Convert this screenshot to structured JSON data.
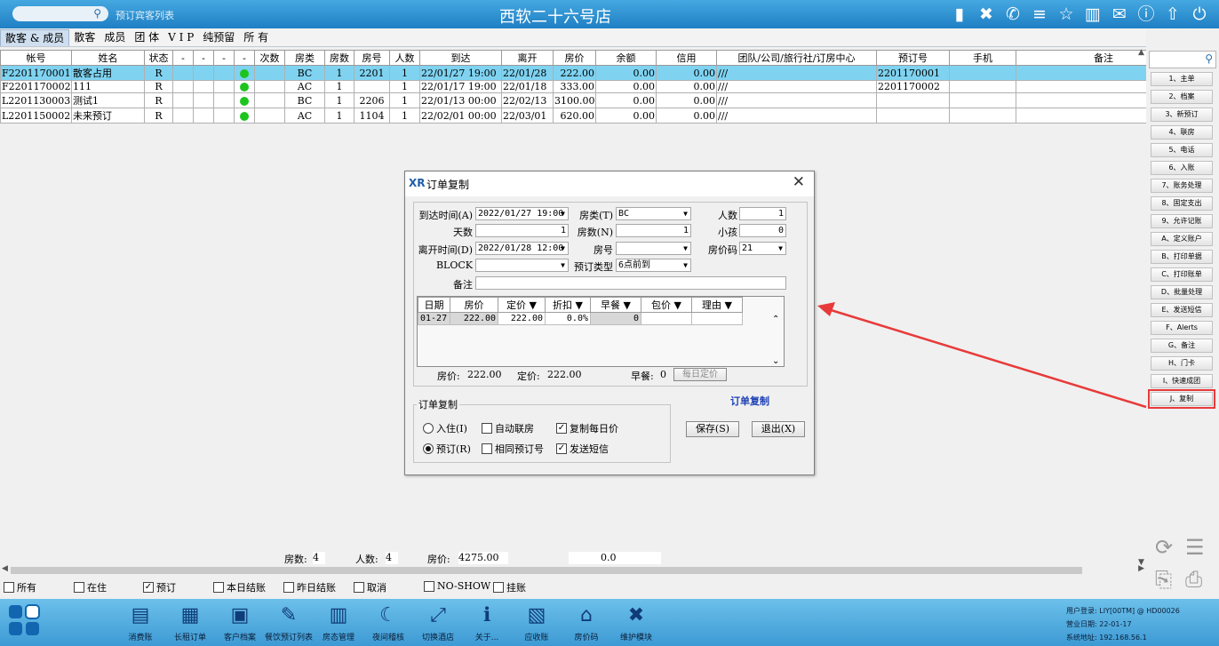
{
  "titlebar": {
    "search_placeholder": "",
    "breadcrumb": "预订宾客列表",
    "title": "西软二十六号店",
    "icons": [
      "signal-icon",
      "tools-icon",
      "phone-icon",
      "menu-icon",
      "star-icon",
      "columns-icon",
      "mail-icon",
      "help-icon",
      "upload-icon",
      "power-icon"
    ]
  },
  "tabs": [
    "散客 & 成员",
    "散客",
    "成员",
    "团 体",
    "V I P",
    "纯预留",
    "所 有"
  ],
  "grid": {
    "headers": [
      "帐号",
      "姓名",
      "状态",
      "-",
      "-",
      "-",
      "-",
      "次数",
      "房类",
      "房数",
      "房号",
      "人数",
      "到达",
      "离开",
      "房价",
      "余额",
      "信用",
      "团队/公司/旅行社/订房中心",
      "预订号",
      "手机",
      "备注"
    ],
    "rows": [
      {
        "acct": "F2201170001",
        "name": "散客占用",
        "status": "R",
        "room_type": "BC",
        "rooms": "1",
        "room_no": "2201",
        "persons": "1",
        "arrive": "22/01/27 19:00",
        "depart": "22/01/28",
        "rate": "222.00",
        "balance": "0.00",
        "credit": "0.00",
        "org": "///",
        "resv_no": "2201170001",
        "mobile": "",
        "note": ""
      },
      {
        "acct": "F2201170002",
        "name": "111",
        "status": "R",
        "room_type": "AC",
        "rooms": "1",
        "room_no": "",
        "persons": "1",
        "arrive": "22/01/17 19:00",
        "depart": "22/01/18",
        "rate": "333.00",
        "balance": "0.00",
        "credit": "0.00",
        "org": "///",
        "resv_no": "2201170002",
        "mobile": "",
        "note": ""
      },
      {
        "acct": "L2201130003",
        "name": "测试1",
        "status": "R",
        "room_type": "BC",
        "rooms": "1",
        "room_no": "2206",
        "persons": "1",
        "arrive": "22/01/13 00:00",
        "depart": "22/02/13",
        "rate": "3100.00",
        "balance": "0.00",
        "credit": "0.00",
        "org": "///",
        "resv_no": "",
        "mobile": "",
        "note": ""
      },
      {
        "acct": "L2201150002",
        "name": "未来预订",
        "status": "R",
        "room_type": "AC",
        "rooms": "1",
        "room_no": "1104",
        "persons": "1",
        "arrive": "22/02/01 00:00",
        "depart": "22/03/01",
        "rate": "620.00",
        "balance": "0.00",
        "credit": "0.00",
        "org": "///",
        "resv_no": "",
        "mobile": "",
        "note": ""
      }
    ]
  },
  "right_panel": {
    "buttons": [
      "1、主单",
      "2、档案",
      "3、新预订",
      "4、联房",
      "5、电话",
      "6、入账",
      "7、账务处理",
      "8、固定支出",
      "9、允许记账",
      "A、定义账户",
      "B、打印单据",
      "C、打印账单",
      "D、批量处理",
      "E、发送短信",
      "F、Alerts",
      "G、备注",
      "H、门卡",
      "I、快速成团",
      "J、复制"
    ]
  },
  "dialog": {
    "logo": "XR",
    "title": "订单复制",
    "labels": {
      "arrival": "到达时间(A)",
      "room_type": "房类(T)",
      "persons": "人数",
      "days": "天数",
      "rooms": "房数(N)",
      "children": "小孩",
      "departure": "离开时间(D)",
      "room_no": "房号",
      "rate_code": "房价码",
      "block": "BLOCK",
      "resv_type": "预订类型",
      "remark": "备注"
    },
    "values": {
      "arrival": "2022/01/27 19:00",
      "room_type": "BC",
      "persons": "1",
      "days": "1",
      "rooms": "1",
      "children": "0",
      "departure": "2022/01/28 12:00",
      "room_no": "",
      "rate_code": "21",
      "block": "",
      "resv_type": "6点前到",
      "remark": ""
    },
    "subgrid": {
      "headers": [
        "日期",
        "房价",
        "定价 ▼",
        "折扣 ▼",
        "早餐 ▼",
        "包价 ▼",
        "理由 ▼"
      ],
      "row": [
        "01-27",
        "222.00",
        "222.00",
        "0.0%",
        "0",
        "",
        ""
      ]
    },
    "summary": {
      "rate_label": "房价:",
      "rate_value": "222.00",
      "list_label": "定价:",
      "list_value": "222.00",
      "bf_label": "早餐:",
      "bf_value": "0",
      "daily_button": "每日定价"
    },
    "copy_link": "订单复制",
    "group_label": "订单复制",
    "options": {
      "checkin": "入住(I)",
      "reserve": "预订(R)",
      "auto_link": "自动联房",
      "same_resv": "相同预订号",
      "copy_daily": "复制每日价",
      "send_sms": "发送短信"
    },
    "save": "保存(S)",
    "exit": "退出(X)"
  },
  "totals": {
    "rooms_label": "房数:",
    "rooms_value": "4",
    "persons_label": "人数:",
    "persons_value": "4",
    "rate_label": "房价:",
    "rate_value": "4275.00",
    "balance_value": "0.0"
  },
  "filters": [
    {
      "label": "所有",
      "checked": false
    },
    {
      "label": "在住",
      "checked": false
    },
    {
      "label": "预订",
      "checked": true
    },
    {
      "label": "本日结账",
      "checked": false
    },
    {
      "label": "昨日结账",
      "checked": false
    },
    {
      "label": "取消",
      "checked": false
    },
    {
      "label": "NO-SHOW",
      "checked": false
    },
    {
      "label": "挂账",
      "checked": false
    }
  ],
  "toolbar": [
    {
      "label": "消费账",
      "icon": "money-stack-icon",
      "glyph": "▤"
    },
    {
      "label": "长租订单",
      "icon": "building-icon",
      "glyph": "▦"
    },
    {
      "label": "客户档案",
      "icon": "id-card-icon",
      "glyph": "▣"
    },
    {
      "label": "餐饮预订列表",
      "icon": "order-list-icon",
      "glyph": "✎"
    },
    {
      "label": "房态管理",
      "icon": "grid-icon",
      "glyph": "▥"
    },
    {
      "label": "夜间稽核",
      "icon": "moon-icon",
      "glyph": "☾"
    },
    {
      "label": "切换酒店",
      "icon": "switch-icon",
      "glyph": "⤢"
    },
    {
      "label": "关于...",
      "icon": "info-icon",
      "glyph": "ℹ"
    },
    {
      "label": "应收账",
      "icon": "clipboard-icon",
      "glyph": "▧"
    },
    {
      "label": "房价码",
      "icon": "house-icon",
      "glyph": "⌂"
    },
    {
      "label": "维护模块",
      "icon": "wrench-icon",
      "glyph": "✖"
    }
  ],
  "sysinfo": {
    "user": "用户登录: LIY[00TM] @ HD00026",
    "date": "营业日期: 22-01-17",
    "ip": "系统地址: 192.168.56.1"
  },
  "colors": {
    "titlebar": "#1f7fc4",
    "selected_row": "#7fd3f1",
    "status_dot": "#1ec41e",
    "highlight": "#e83a3a",
    "link": "#1b3fb5"
  }
}
